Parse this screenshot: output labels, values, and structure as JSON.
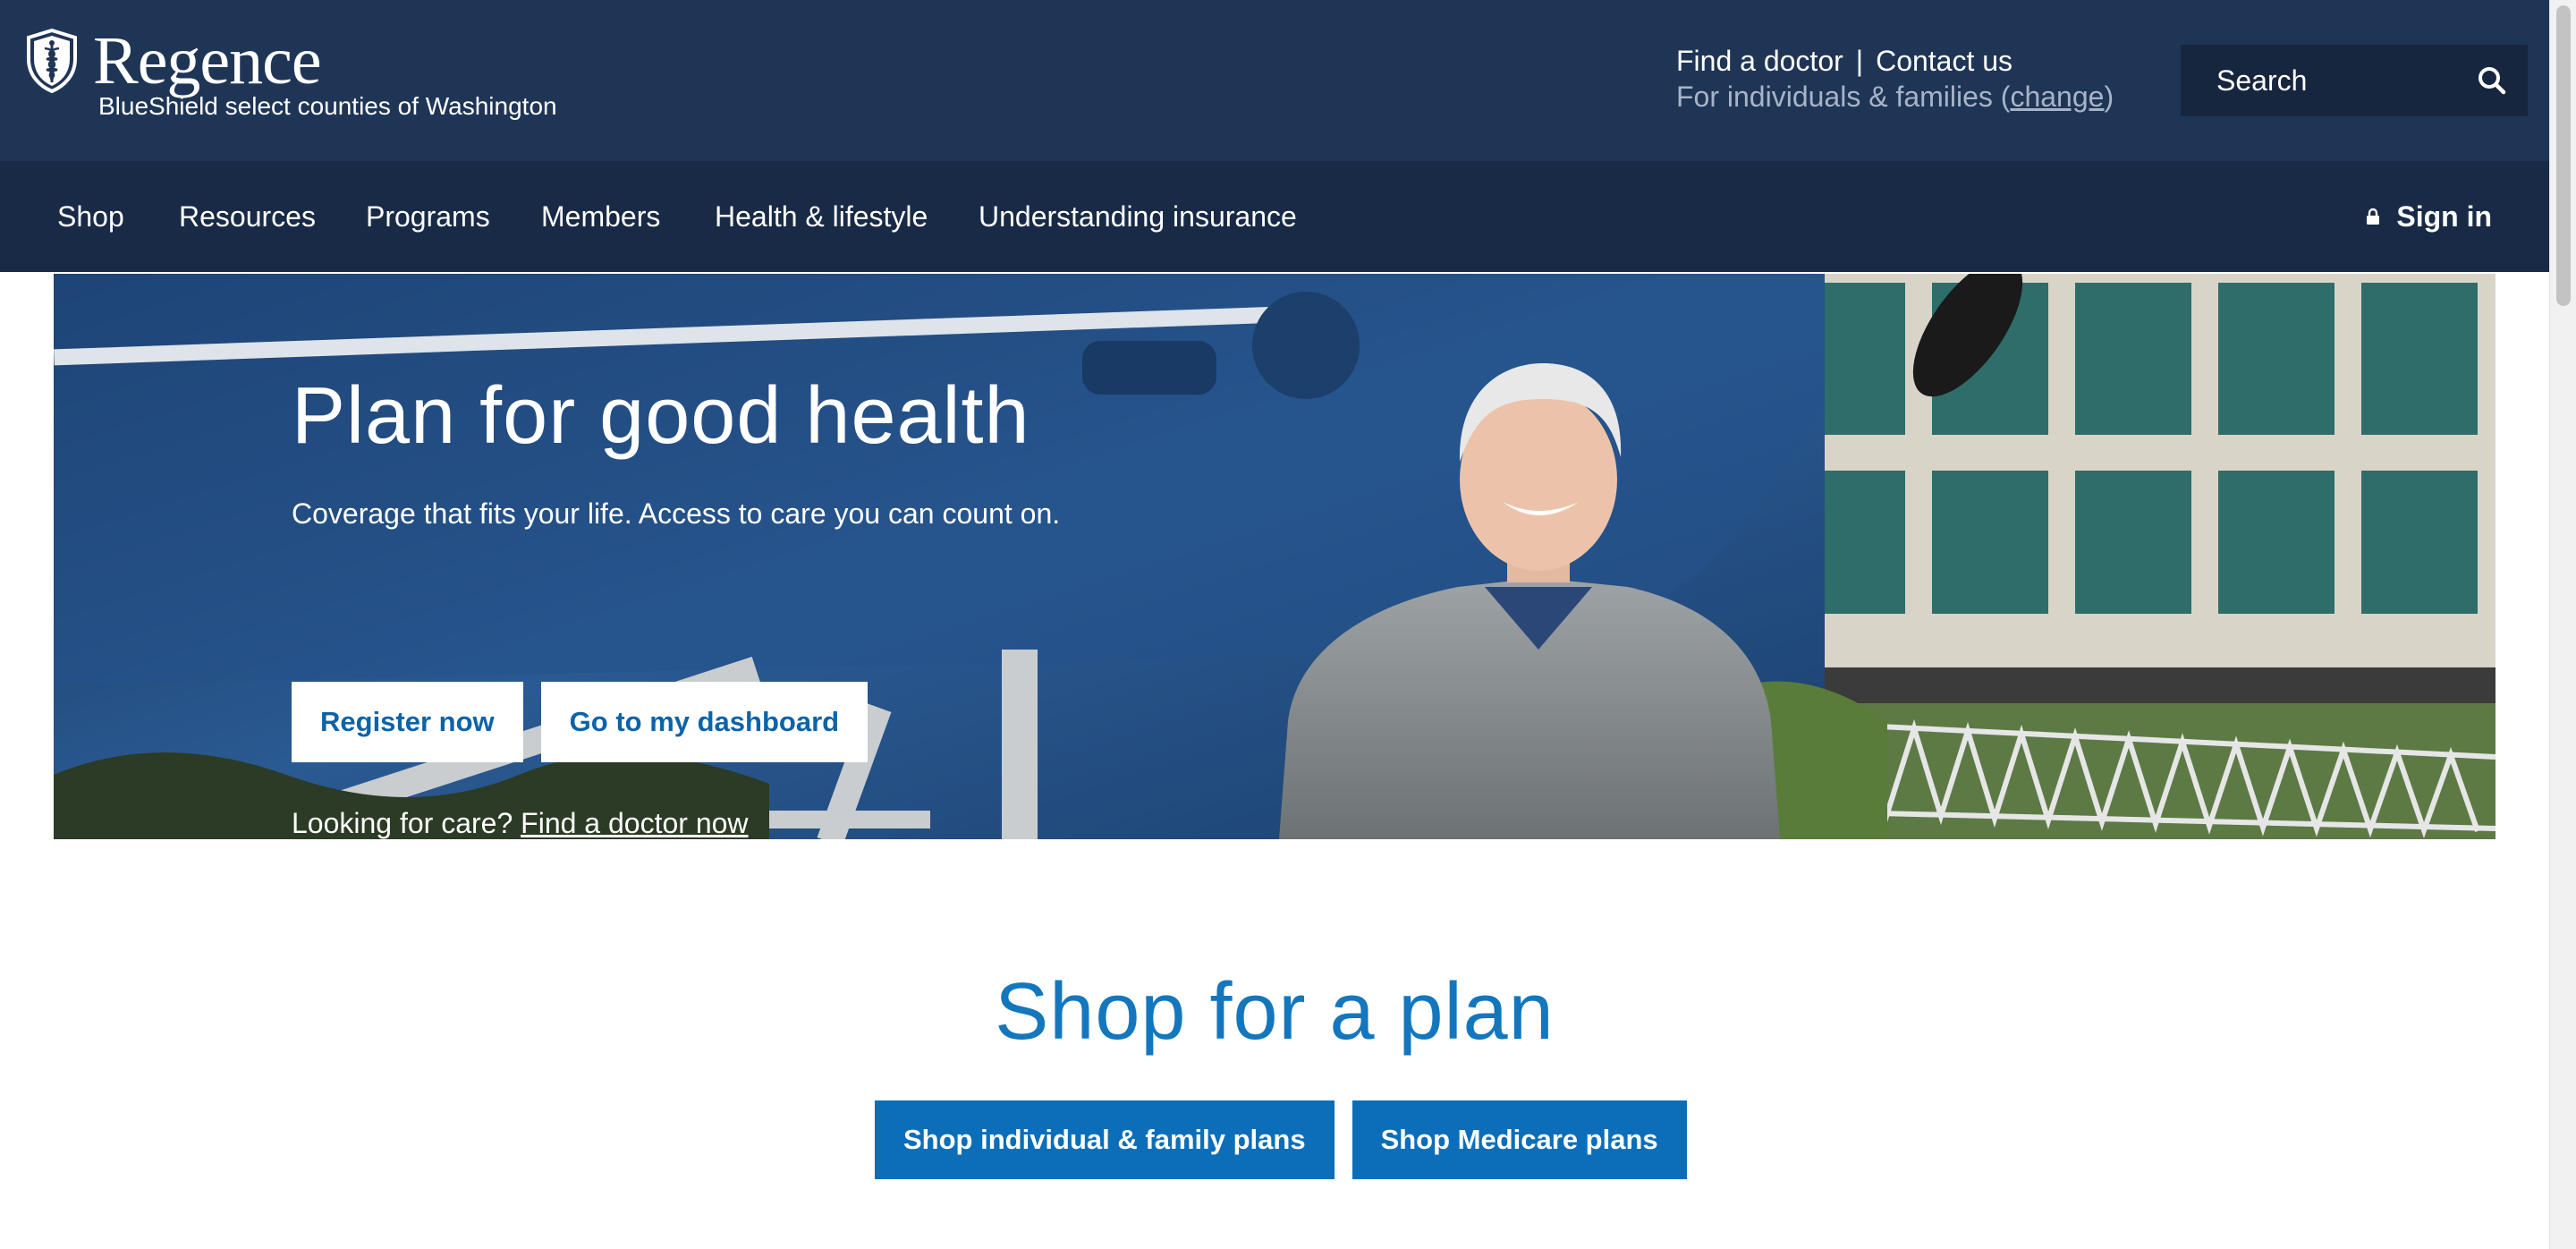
{
  "brand": {
    "name": "Regence",
    "tagline": "BlueShield select counties of Washington"
  },
  "utility": {
    "find_doctor": "Find a doctor",
    "separator": "|",
    "contact": "Contact us",
    "audience_prefix": "For individuals & families (",
    "audience_change": "change",
    "audience_suffix": ")"
  },
  "search": {
    "placeholder": "Search",
    "icon": "search-icon"
  },
  "nav": {
    "items": [
      {
        "label": "Shop"
      },
      {
        "label": "Resources"
      },
      {
        "label": "Programs"
      },
      {
        "label": "Members"
      },
      {
        "label": "Health & lifestyle"
      },
      {
        "label": "Understanding insurance"
      }
    ],
    "sign_in": "Sign in",
    "sign_in_icon": "lock-icon"
  },
  "hero": {
    "title": "Plan for good health",
    "subtitle": "Coverage that fits your life. Access to care you can count on.",
    "primary_button": "Register now",
    "secondary_button": "Go to my dashboard",
    "care_prefix": "Looking for care?",
    "care_link": "Find a doctor now"
  },
  "shop": {
    "title": "Shop for a plan",
    "individual_button": "Shop individual & family plans",
    "medicare_button": "Shop Medicare plans"
  },
  "colors": {
    "header_bg": "#1f3556",
    "nav_bg": "#182a45",
    "accent_blue": "#0c6eb8",
    "heading_blue": "#1477bd"
  }
}
